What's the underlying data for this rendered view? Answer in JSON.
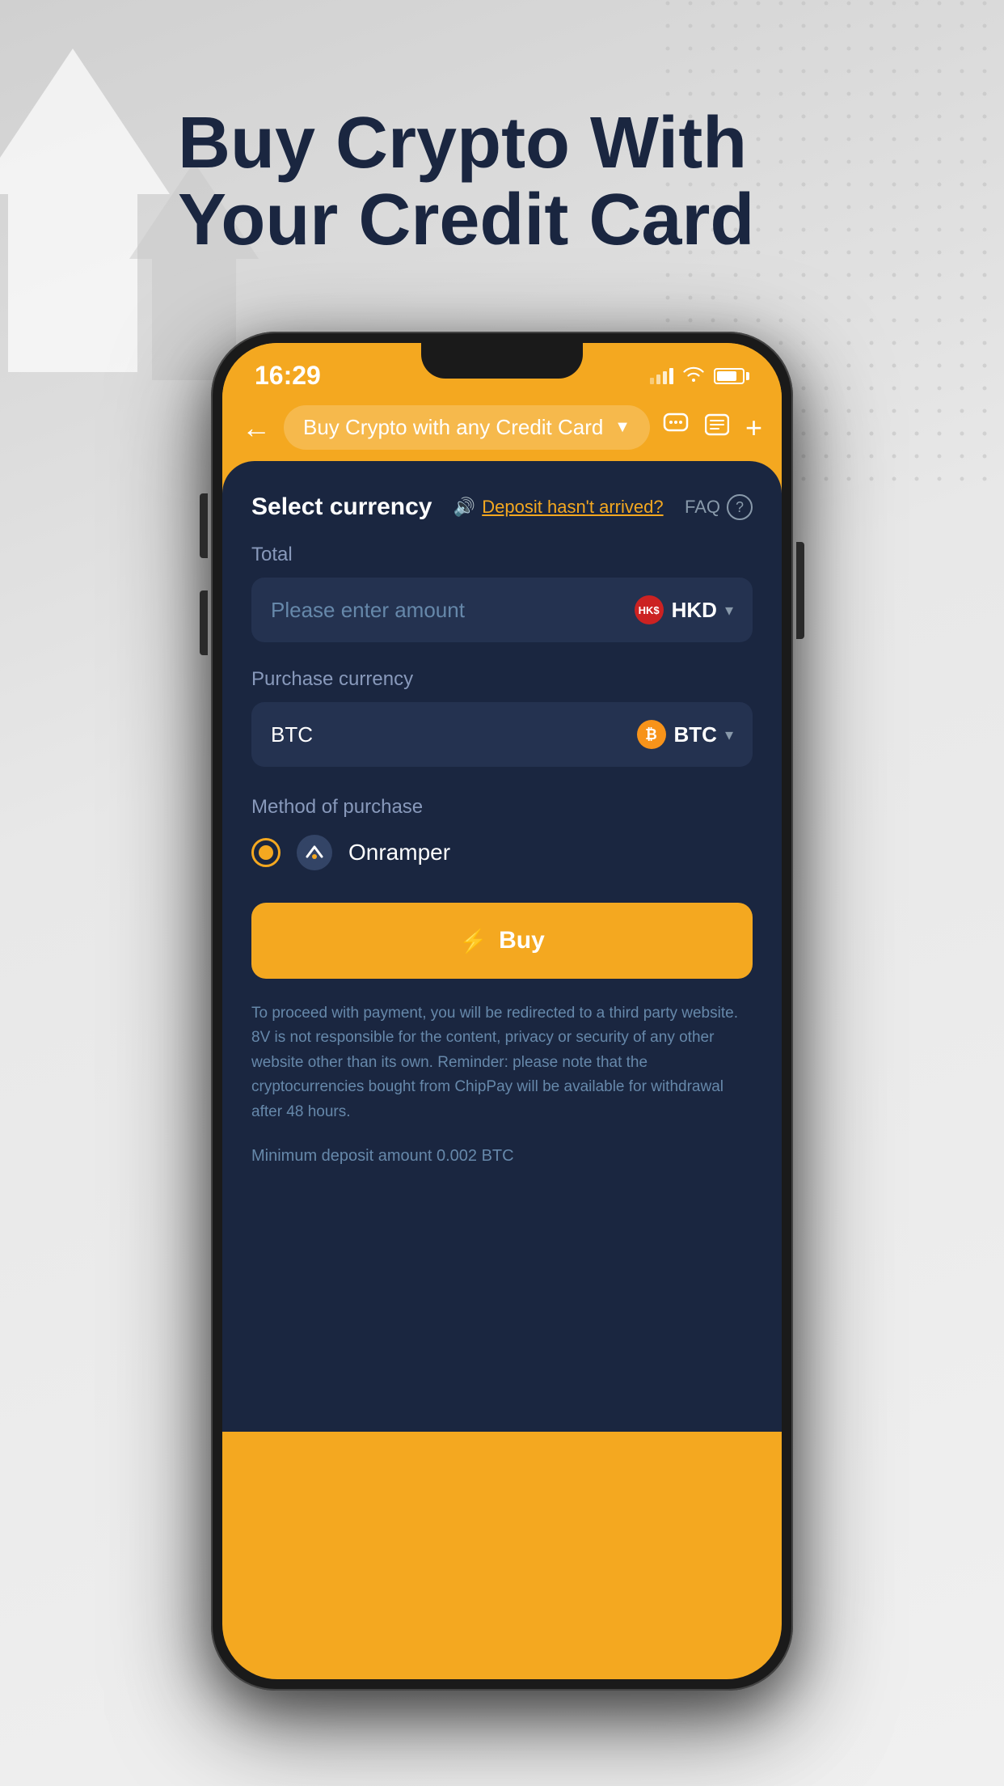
{
  "page": {
    "background_color": "#e0e0e0",
    "headline_line1": "Buy Crypto With",
    "headline_line2": "Your Credit Card"
  },
  "status_bar": {
    "time": "16:29",
    "signal": "signal-icon",
    "wifi": "wifi-icon",
    "battery": "battery-icon"
  },
  "nav": {
    "back_label": "←",
    "title": "Buy Crypto with any Credit Card",
    "dropdown_arrow": "▼",
    "chat_icon": "chat-icon",
    "list_icon": "list-icon",
    "plus_icon": "plus-icon"
  },
  "form": {
    "select_currency_label": "Select currency",
    "deposit_speaker": "🔊",
    "deposit_link_text": "Deposit hasn't arrived?",
    "faq_label": "FAQ",
    "total_label": "Total",
    "amount_placeholder": "Please enter amount",
    "fiat_currency": "HKD",
    "fiat_currency_badge": "HK$",
    "purchase_currency_label": "Purchase currency",
    "btc_left_label": "BTC",
    "crypto_currency": "BTC",
    "method_label": "Method of purchase",
    "method_name": "Onramper",
    "buy_button_label": "Buy",
    "buy_lightning": "⚡",
    "disclaimer": "To proceed with payment, you will be redirected to a third party website. 8V is not responsible for the content, privacy or security of any other website other than its own. Reminder: please note that the cryptocurrencies bought from ChipPay will be available for withdrawal after 48 hours.",
    "min_deposit": "Minimum deposit amount 0.002 BTC"
  }
}
